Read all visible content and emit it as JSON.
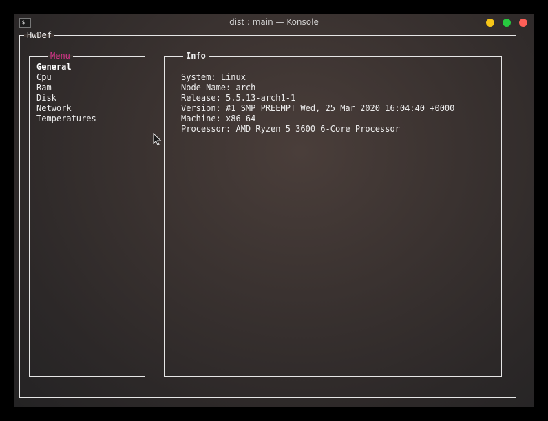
{
  "window": {
    "title": "dist : main — Konsole",
    "terminal_icon": "$_"
  },
  "app": {
    "title": "HwDef"
  },
  "menu": {
    "title": "Menu",
    "items": [
      {
        "label": "General",
        "active": true
      },
      {
        "label": "Cpu"
      },
      {
        "label": "Ram"
      },
      {
        "label": "Disk"
      },
      {
        "label": "Network"
      },
      {
        "label": "Temperatures"
      }
    ]
  },
  "info": {
    "title": "Info",
    "lines": [
      {
        "label": "System:",
        "value": "Linux"
      },
      {
        "label": "Node Name:",
        "value": "arch"
      },
      {
        "label": "Release:",
        "value": "5.5.13-arch1-1"
      },
      {
        "label": "Version:",
        "value": "#1 SMP PREEMPT Wed, 25 Mar 2020 16:04:40 +0000"
      },
      {
        "label": "Machine:",
        "value": "x86_64"
      },
      {
        "label": "Processor:",
        "value": "AMD Ryzen 5 3600 6-Core Processor"
      }
    ]
  },
  "colors": {
    "menu_title": "#d6338a",
    "minimize": "#f5c518",
    "maximize": "#27c93f",
    "close": "#fe5f57"
  },
  "icons": {
    "terminal": "terminal-icon",
    "cursor": "mouse-pointer-icon"
  }
}
